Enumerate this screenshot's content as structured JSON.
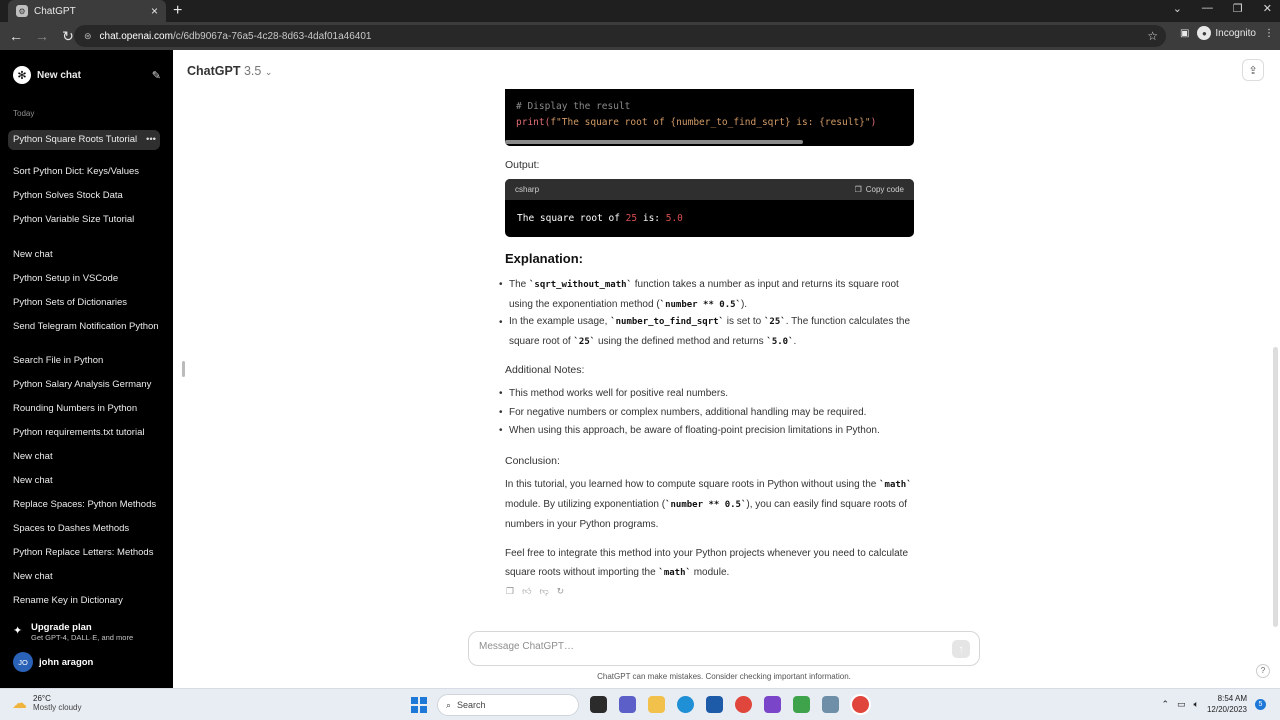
{
  "browser": {
    "tab_title": "ChatGPT",
    "tab_favicon": "⚙",
    "url_host": "chat.openai.com",
    "url_path": "/c/6db9067a-76a5-4c28-8d63-4daf01a46401",
    "incognito_label": "Incognito"
  },
  "sidebar": {
    "new_chat_label": "New chat",
    "section_today": "Today",
    "active_chat": "Python Square Roots Tutorial",
    "chats": [
      "Sort Python Dict: Keys/Values",
      "Python Solves Stock Data",
      "Python Variable Size Tutorial",
      "New chat",
      "Python Setup in VSCode",
      "Python Sets of Dictionaries",
      "Send Telegram Notification Python",
      "Search File in Python",
      "Python Salary Analysis Germany",
      "Rounding Numbers in Python",
      "Python requirements.txt tutorial",
      "New chat",
      "New chat",
      "Replace Spaces: Python Methods",
      "Spaces to Dashes Methods",
      "Python Replace Letters: Methods",
      "New chat",
      "Rename Key in Dictionary"
    ],
    "upgrade_title": "Upgrade plan",
    "upgrade_sub": "Get GPT-4, DALL·E, and more",
    "user_initials": "JO",
    "user_name": "john aragon"
  },
  "header": {
    "model_name": "ChatGPT",
    "model_version": "3.5"
  },
  "message": {
    "code1_line1": "# Display the result",
    "code1_line2_fn": "print(",
    "code1_line2_str": "f\"The square root of {number_to_find_sqrt} is: {result}\"",
    "code1_line2_end": ")",
    "output_label": "Output:",
    "code2_lang": "csharp",
    "code2_copy": "Copy code",
    "code2_text1": "The square root of ",
    "code2_num1": "25",
    "code2_text2": " is: ",
    "code2_num2": "5.0",
    "explanation_heading": "Explanation:",
    "b1_a": "The ",
    "b1_code1": "`sqrt_without_math`",
    "b1_b": " function takes a number as input and returns its square root using the exponentiation method (",
    "b1_code2": "`number ** 0.5`",
    "b1_c": ").",
    "b2_a": "In the example usage, ",
    "b2_code1": "`number_to_find_sqrt`",
    "b2_b": " is set to ",
    "b2_code2": "`25`",
    "b2_c": ". The function calculates the square root of ",
    "b2_code3": "`25`",
    "b2_d": " using the defined method and returns ",
    "b2_code4": "`5.0`",
    "b2_e": ".",
    "notes_label": "Additional Notes:",
    "note1": "This method works well for positive real numbers.",
    "note2": "For negative numbers or complex numbers, additional handling may be required.",
    "note3": "When using this approach, be aware of floating-point precision limitations in Python.",
    "conclusion_label": "Conclusion:",
    "c1_a": "In this tutorial, you learned how to compute square roots in Python without using the ",
    "c1_code1": "`math`",
    "c1_b": " module. By utilizing exponentiation (",
    "c1_code2": "`number ** 0.5`",
    "c1_c": "), you can easily find square roots of numbers in your Python programs.",
    "c2_a": "Feel free to integrate this method into your Python projects whenever you need to calculate square roots without importing the ",
    "c2_code": "`math`",
    "c2_b": " module."
  },
  "composer": {
    "placeholder": "Message ChatGPT…",
    "disclaimer": "ChatGPT can make mistakes. Consider checking important information."
  },
  "taskbar": {
    "temp": "26°C",
    "condition": "Mostly cloudy",
    "search_label": "Search",
    "time": "8:54 AM",
    "date": "12/20/2023",
    "notif_count": "5"
  }
}
